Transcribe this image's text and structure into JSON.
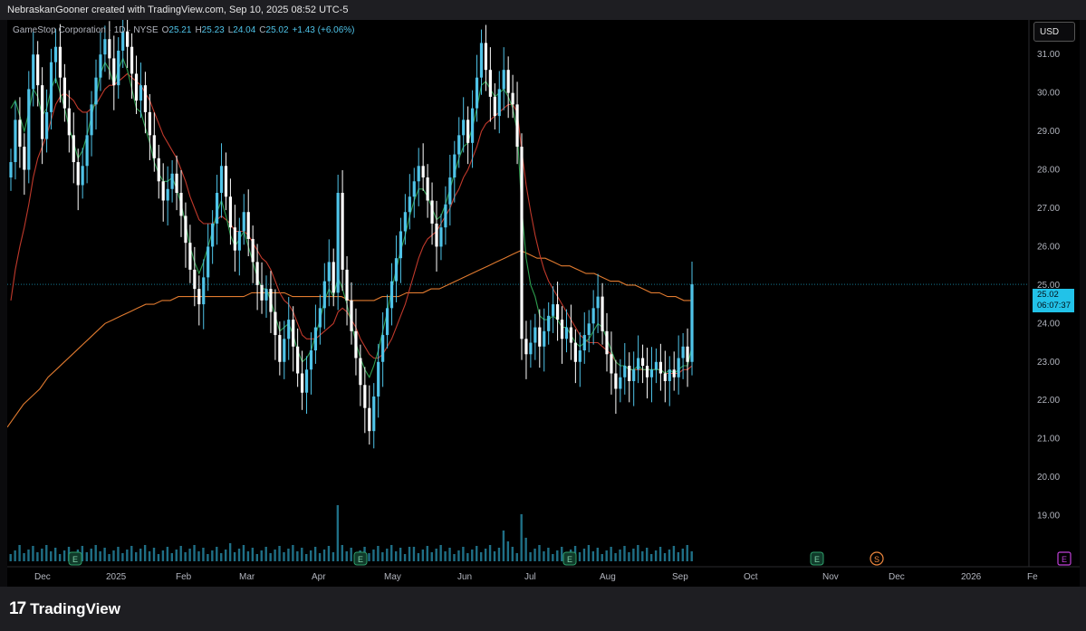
{
  "header": {
    "credit": "NebraskanGooner created with TradingView.com, Sep 10, 2025 08:52 UTC-5"
  },
  "legend": {
    "symbol": "GameStop Corporation · 1D · NYSE",
    "o_label": "O",
    "o_value": "25.21",
    "h_label": "H",
    "h_value": "25.23",
    "l_label": "L",
    "l_value": "24.04",
    "c_label": "C",
    "c_value": "25.02",
    "change": "+1.43 (+6.06%)"
  },
  "currency_button": "USD",
  "last_price": {
    "price": "25.02",
    "countdown": "06:07:37"
  },
  "footer": {
    "brand": "TradingView"
  },
  "colors": {
    "accent": "#22c2e8",
    "ma_short": "#2e9e4f",
    "ma_mid": "#c0392b",
    "ma_long": "#e07a2f"
  },
  "events": [
    {
      "type": "E",
      "label": "E",
      "x_date": "2024-12-10"
    },
    {
      "type": "E",
      "label": "E",
      "x_date": "2025-03-25"
    },
    {
      "type": "E",
      "label": "E",
      "x_date": "2025-06-10"
    },
    {
      "type": "S",
      "label": "S",
      "x_date": "2025-10-01"
    },
    {
      "type": "E",
      "label": "E",
      "x_date": "2025-09-09"
    },
    {
      "type": "E-future",
      "label": "E",
      "x_date": "2025-12-09"
    }
  ],
  "chart_data": {
    "type": "candlestick",
    "y_axis": {
      "ticks": [
        "19.00",
        "20.00",
        "21.00",
        "22.00",
        "23.00",
        "24.00",
        "25.00",
        "26.00",
        "27.00",
        "28.00",
        "29.00",
        "30.00",
        "31.00"
      ],
      "ylim": [
        18.0,
        31.9
      ]
    },
    "x_axis": {
      "ticks": [
        "Dec",
        "2025",
        "Feb",
        "Mar",
        "Apr",
        "May",
        "Jun",
        "Jul",
        "Aug",
        "Sep",
        "Oct",
        "Nov",
        "Dec",
        "2026",
        "Fe"
      ]
    },
    "close_series": [
      28.2,
      29.3,
      28.6,
      28.0,
      30.1,
      31.0,
      30.2,
      28.8,
      29.5,
      30.8,
      31.2,
      30.4,
      29.6,
      28.9,
      28.2,
      27.6,
      28.1,
      28.9,
      29.7,
      30.4,
      31.0,
      31.4,
      30.9,
      30.2,
      31.1,
      31.6,
      31.2,
      30.5,
      29.8,
      30.2,
      29.5,
      28.9,
      28.3,
      27.7,
      27.2,
      27.5,
      27.9,
      27.4,
      26.8,
      26.1,
      25.4,
      24.9,
      24.5,
      25.2,
      26.0,
      26.6,
      27.4,
      28.1,
      27.3,
      26.5,
      25.9,
      26.4,
      26.9,
      26.2,
      25.6,
      25.0,
      24.6,
      24.9,
      24.3,
      23.7,
      23.0,
      23.6,
      24.1,
      23.4,
      22.7,
      22.2,
      22.8,
      23.3,
      23.9,
      24.4,
      25.1,
      25.6,
      24.8,
      27.4,
      25.4,
      24.6,
      23.8,
      23.1,
      22.4,
      21.8,
      21.2,
      22.1,
      23.0,
      23.7,
      24.4,
      25.1,
      25.7,
      26.4,
      26.9,
      27.3,
      27.7,
      28.1,
      27.8,
      27.2,
      26.6,
      26.0,
      26.5,
      27.1,
      27.8,
      28.4,
      28.9,
      29.3,
      28.7,
      29.6,
      30.4,
      31.3,
      30.6,
      29.9,
      29.4,
      30.1,
      30.6,
      30.0,
      29.7,
      28.6,
      23.6,
      23.2,
      23.5,
      23.9,
      23.4,
      23.8,
      24.2,
      24.5,
      24.1,
      23.6,
      23.9,
      23.5,
      23.0,
      23.3,
      23.7,
      24.0,
      24.4,
      24.7,
      23.8,
      23.2,
      22.7,
      22.3,
      22.6,
      22.9,
      22.5,
      22.8,
      23.1,
      22.9,
      22.6,
      22.8,
      23.0,
      22.7,
      22.5,
      22.8,
      22.6,
      23.1,
      23.4,
      23.0,
      25.02
    ],
    "ma_short": [
      29.6,
      29.8,
      29.4,
      29.0,
      29.5,
      30.1,
      29.9,
      29.4,
      29.6,
      30.1,
      30.4,
      30.0,
      29.6,
      29.1,
      28.7,
      28.3,
      28.5,
      28.9,
      29.4,
      29.9,
      30.5,
      30.8,
      30.6,
      30.2,
      30.6,
      30.9,
      30.6,
      30.1,
      29.6,
      29.5,
      29.1,
      28.7,
      28.2,
      27.9,
      27.7,
      27.7,
      27.8,
      27.5,
      27.1,
      26.6,
      26.0,
      25.6,
      25.3,
      25.6,
      26.0,
      26.4,
      26.9,
      27.2,
      26.8,
      26.3,
      26.0,
      26.2,
      26.4,
      26.0,
      25.6,
      25.2,
      24.9,
      24.9,
      24.6,
      24.2,
      23.8,
      23.9,
      24.0,
      23.7,
      23.3,
      23.0,
      23.1,
      23.3,
      23.7,
      24.1,
      24.6,
      24.9,
      24.7,
      25.2,
      24.9,
      24.5,
      24.0,
      23.5,
      23.1,
      22.8,
      22.6,
      22.9,
      23.3,
      23.8,
      24.3,
      24.9,
      25.4,
      25.9,
      26.3,
      26.8,
      27.2,
      27.5,
      27.5,
      27.3,
      27.0,
      26.7,
      26.8,
      27.1,
      27.5,
      27.9,
      28.3,
      28.6,
      28.7,
      29.1,
      29.6,
      30.2,
      30.3,
      30.1,
      29.9,
      30.0,
      30.1,
      29.9,
      29.6,
      29.0,
      27.0,
      25.7,
      25.0,
      24.7,
      24.2,
      24.1,
      24.1,
      24.2,
      24.1,
      23.9,
      23.9,
      23.7,
      23.5,
      23.4,
      23.5,
      23.6,
      23.8,
      24.0,
      23.9,
      23.6,
      23.3,
      23.0,
      22.9,
      22.9,
      22.8,
      22.8,
      22.9,
      22.8,
      22.8,
      22.8,
      22.8,
      22.8,
      22.7,
      22.8,
      22.7,
      22.8,
      22.9,
      22.9,
      23.4
    ],
    "ma_mid": [
      24.6,
      25.4,
      26.0,
      26.5,
      27.1,
      27.8,
      28.3,
      28.6,
      28.9,
      29.3,
      29.7,
      29.9,
      30.0,
      29.9,
      29.8,
      29.6,
      29.5,
      29.5,
      29.6,
      29.7,
      29.9,
      30.1,
      30.2,
      30.2,
      30.3,
      30.4,
      30.5,
      30.4,
      30.3,
      30.2,
      30.0,
      29.8,
      29.5,
      29.2,
      28.9,
      28.7,
      28.5,
      28.3,
      28.0,
      27.7,
      27.3,
      27.0,
      26.7,
      26.6,
      26.6,
      26.6,
      26.7,
      26.8,
      26.7,
      26.6,
      26.4,
      26.4,
      26.4,
      26.3,
      26.1,
      25.9,
      25.7,
      25.6,
      25.4,
      25.1,
      24.8,
      24.6,
      24.5,
      24.3,
      24.0,
      23.7,
      23.6,
      23.6,
      23.6,
      23.7,
      23.8,
      23.9,
      24.0,
      24.3,
      24.4,
      24.3,
      24.1,
      23.9,
      23.6,
      23.4,
      23.2,
      23.1,
      23.1,
      23.2,
      23.4,
      23.6,
      23.9,
      24.2,
      24.5,
      24.9,
      25.3,
      25.7,
      26.0,
      26.2,
      26.3,
      26.4,
      26.6,
      26.8,
      27.0,
      27.3,
      27.5,
      27.8,
      28.0,
      28.3,
      28.6,
      29.0,
      29.2,
      29.3,
      29.4,
      29.5,
      29.6,
      29.7,
      29.7,
      29.5,
      28.5,
      27.6,
      26.9,
      26.3,
      25.8,
      25.4,
      25.1,
      24.9,
      24.7,
      24.5,
      24.3,
      24.1,
      23.9,
      23.7,
      23.6,
      23.5,
      23.5,
      23.5,
      23.4,
      23.3,
      23.2,
      23.0,
      22.9,
      22.9,
      22.8,
      22.8,
      22.8,
      22.8,
      22.8,
      22.8,
      22.8,
      22.8,
      22.7,
      22.7,
      22.7,
      22.7,
      22.8,
      22.8,
      22.9
    ],
    "ma_long": [
      21.3,
      21.6,
      21.9,
      22.1,
      22.3,
      22.6,
      22.8,
      23.0,
      23.2,
      23.4,
      23.6,
      23.8,
      24.0,
      24.1,
      24.2,
      24.3,
      24.4,
      24.5,
      24.5,
      24.6,
      24.6,
      24.7,
      24.7,
      24.7,
      24.7,
      24.7,
      24.7,
      24.7,
      24.7,
      24.7,
      24.8,
      24.8,
      24.8,
      24.8,
      24.8,
      24.7,
      24.7,
      24.7,
      24.7,
      24.7,
      24.7,
      24.7,
      24.6,
      24.6,
      24.6,
      24.6,
      24.7,
      24.7,
      24.7,
      24.8,
      24.8,
      24.8,
      24.9,
      24.9,
      25.0,
      25.1,
      25.2,
      25.3,
      25.4,
      25.5,
      25.6,
      25.7,
      25.8,
      25.9,
      25.8,
      25.7,
      25.7,
      25.6,
      25.5,
      25.5,
      25.4,
      25.3,
      25.3,
      25.2,
      25.1,
      25.1,
      25.0,
      25.0,
      24.9,
      24.8,
      24.8,
      24.7,
      24.7,
      24.6,
      24.6
    ]
  }
}
